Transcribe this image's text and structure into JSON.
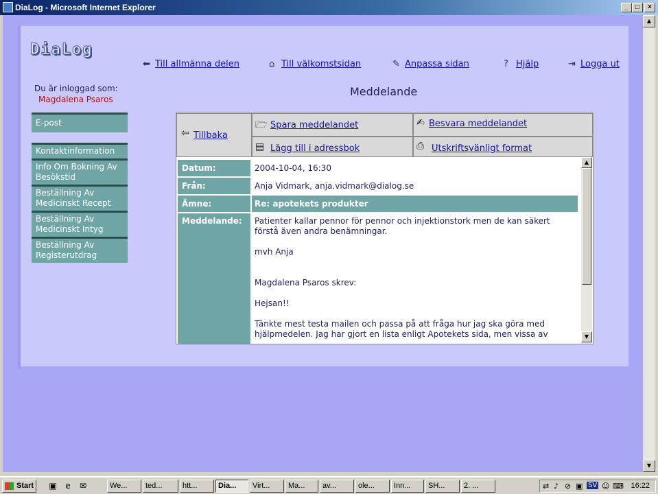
{
  "window": {
    "title": "DiaLog - Microsoft Internet Explorer",
    "min": "_",
    "max": "□",
    "close": "×"
  },
  "colors": {
    "page_bg": "#a7a7f6",
    "panel": "#c9c9fb",
    "teal": "#6fa5a5",
    "link": "#1515a0",
    "user_name": "#aa1010"
  },
  "header": {
    "logo": "DiaLog",
    "links": [
      {
        "label": "Till allmänna delen",
        "icon": "arrow-left-icon"
      },
      {
        "label": "Till välkomstsidan",
        "icon": "home-icon"
      },
      {
        "label": "Anpassa sidan",
        "icon": "pencil-icon"
      },
      {
        "label": "Hjälp",
        "icon": "help-icon"
      },
      {
        "label": "Logga ut",
        "icon": "logout-icon"
      }
    ]
  },
  "login": {
    "label": "Du är inloggad som:",
    "name": "Magdalena Psaros"
  },
  "page_title": "Meddelande",
  "sidebar": {
    "email": "E-post",
    "items": [
      "Kontaktinformation",
      "Info Om Bokning Av Besökstid",
      "Beställning Av Medicinskt Recept",
      "Beställning Av Medicinskt Intyg",
      "Beställning Av Registerutdrag"
    ]
  },
  "actions": {
    "back": "Tillbaka",
    "save": "Spara meddelandet",
    "reply": "Besvara meddelandet",
    "add_address": "Lägg till i adressbok",
    "print": "Utskriftsvänligt format"
  },
  "message": {
    "date_label": "Datum:",
    "date": "2004-10-04, 16:30",
    "from_label": "Från:",
    "from": "Anja Vidmark, anja.vidmark@dialog.se",
    "subject_label": "Ämne:",
    "subject": "Re: apotekets produkter",
    "body_label": "Meddelande:",
    "body": "Patienter kallar pennor för pennor och injektionstork men de kan säkert\nförstå även andra benämningar.\n\nmvh Anja\n\n\nMagdalena Psaros skrev:\n\nHejsan!!\n\nTänkte mest testa mailen och passa på att fråga hur jag ska göra med\nhjälpmedelen. Jag har gjort en lista enligt Apotekets sida, men vissa av"
  },
  "taskbar": {
    "start": "Start",
    "tasks": [
      "We...",
      "ted...",
      "htt...",
      "Dia...",
      "Virt...",
      "Ma...",
      "av...",
      "ole...",
      "Inn...",
      "SH...",
      "2. ..."
    ],
    "lang": "SV",
    "clock": "16:22"
  }
}
